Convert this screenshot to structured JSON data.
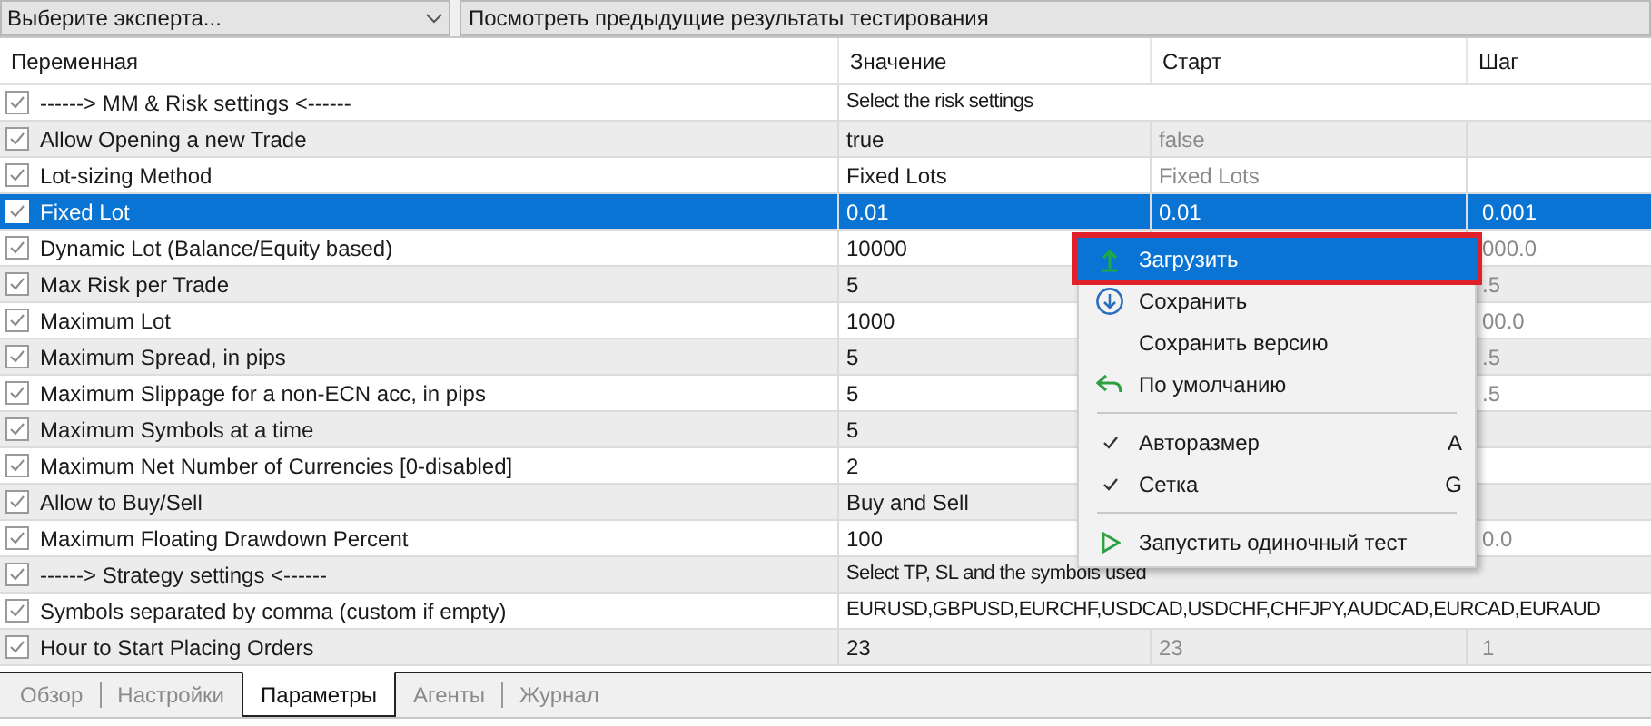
{
  "toolbar": {
    "expert_select": "Выберите эксперта...",
    "history_button": "Посмотреть предыдущие результаты тестирования"
  },
  "table": {
    "columns": [
      "Переменная",
      "Значение",
      "Старт",
      "Шаг"
    ],
    "rows": [
      {
        "kind": "group",
        "checked": true,
        "selected": false,
        "name": "------> MM & Risk settings <------",
        "value": "Select the risk settings"
      },
      {
        "kind": "param",
        "checked": true,
        "selected": false,
        "name": "Allow Opening a new Trade",
        "value": "true",
        "start": "false"
      },
      {
        "kind": "param",
        "checked": true,
        "selected": false,
        "name": "Lot-sizing Method",
        "value": "Fixed Lots",
        "start": "Fixed Lots"
      },
      {
        "kind": "param",
        "checked": true,
        "selected": true,
        "name": "Fixed Lot",
        "value": "0.01",
        "start": "0.01",
        "step": "0.001"
      },
      {
        "kind": "param",
        "checked": true,
        "selected": false,
        "name": "Dynamic Lot (Balance/Equity based)",
        "value": "10000",
        "step": "000.0"
      },
      {
        "kind": "param",
        "checked": true,
        "selected": false,
        "name": "Max Risk per Trade",
        "value": "5",
        "step": ".5"
      },
      {
        "kind": "param",
        "checked": true,
        "selected": false,
        "name": "Maximum Lot",
        "value": "1000",
        "step": "00.0"
      },
      {
        "kind": "param",
        "checked": true,
        "selected": false,
        "name": "Maximum Spread, in pips",
        "value": "5",
        "step": ".5"
      },
      {
        "kind": "param",
        "checked": true,
        "selected": false,
        "name": "Maximum Slippage for a non-ECN acc, in pips",
        "value": "5",
        "step": ".5"
      },
      {
        "kind": "param",
        "checked": true,
        "selected": false,
        "name": "Maximum Symbols at a time",
        "value": "5"
      },
      {
        "kind": "param",
        "checked": true,
        "selected": false,
        "name": "Maximum Net Number of Currencies [0-disabled]",
        "value": "2"
      },
      {
        "kind": "param",
        "checked": true,
        "selected": false,
        "name": "Allow to Buy/Sell",
        "value": "Buy and Sell"
      },
      {
        "kind": "param",
        "checked": true,
        "selected": false,
        "name": "Maximum Floating Drawdown Percent",
        "value": "100",
        "step": "0.0"
      },
      {
        "kind": "group",
        "checked": true,
        "selected": false,
        "name": "------> Strategy settings <------",
        "value": "Select TP, SL and the symbols used"
      },
      {
        "kind": "group",
        "checked": true,
        "selected": false,
        "name": "Symbols separated by comma (custom if empty)",
        "value": "EURUSD,GBPUSD,EURCHF,USDCAD,USDCHF,CHFJPY,AUDCAD,EURCAD,EURAUD"
      },
      {
        "kind": "param",
        "checked": true,
        "selected": false,
        "name": "Hour to Start Placing Orders",
        "value": "23",
        "start": "23",
        "step": "1"
      }
    ]
  },
  "context_menu": {
    "items": [
      {
        "kind": "load",
        "label": "Загрузить",
        "selected": true
      },
      {
        "kind": "save",
        "label": "Сохранить",
        "selected": false
      },
      {
        "kind": "plain",
        "label": "Сохранить версию",
        "selected": false
      },
      {
        "kind": "reset",
        "label": "По умолчанию",
        "selected": false
      },
      {
        "kind": "separator"
      },
      {
        "kind": "check",
        "label": "Авторазмер",
        "checked": true,
        "shortcut": "A",
        "selected": false
      },
      {
        "kind": "check",
        "label": "Сетка",
        "checked": true,
        "shortcut": "G",
        "selected": false
      },
      {
        "kind": "separator"
      },
      {
        "kind": "run",
        "label": "Запустить одиночный тест",
        "selected": false
      }
    ]
  },
  "tabs": [
    {
      "label": "Обзор",
      "selected": false
    },
    {
      "label": "Настройки",
      "selected": false
    },
    {
      "label": "Параметры",
      "selected": true
    },
    {
      "label": "Агенты",
      "selected": false
    },
    {
      "label": "Журнал",
      "selected": false
    }
  ]
}
